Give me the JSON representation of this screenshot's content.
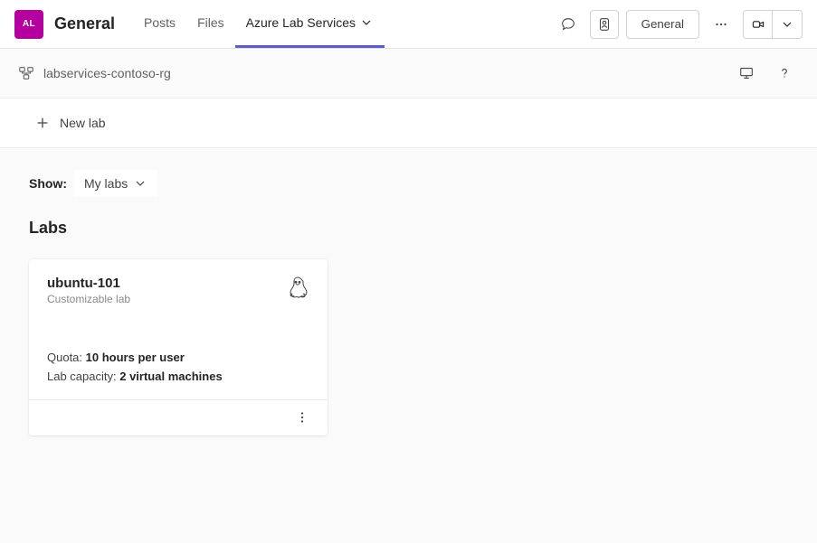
{
  "header": {
    "team_initials": "AL",
    "channel": "General",
    "tabs": [
      "Posts",
      "Files",
      "Azure Lab Services"
    ],
    "active_tab": "Azure Lab Services",
    "right_button": "General"
  },
  "breadcrumb": {
    "resource_group": "labservices-contoso-rg"
  },
  "toolbar": {
    "new_lab": "New lab"
  },
  "filter": {
    "show_label": "Show:",
    "selected": "My labs"
  },
  "section_title": "Labs",
  "labs": [
    {
      "name": "ubuntu-101",
      "subtitle": "Customizable lab",
      "quota_label": "Quota:",
      "quota_value": "10 hours per user",
      "capacity_label": "Lab capacity:",
      "capacity_value": "2 virtual machines",
      "os_icon": "linux"
    }
  ]
}
